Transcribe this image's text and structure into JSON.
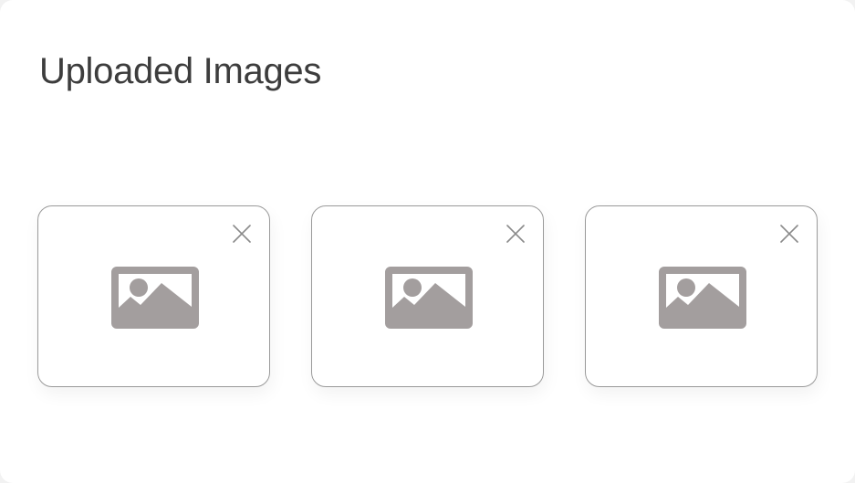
{
  "page": {
    "title": "Uploaded Images"
  },
  "uploads": [
    {
      "icon": "image-placeholder-icon",
      "remove_icon": "close-icon"
    },
    {
      "icon": "image-placeholder-icon",
      "remove_icon": "close-icon"
    },
    {
      "icon": "image-placeholder-icon",
      "remove_icon": "close-icon"
    }
  ],
  "colors": {
    "title": "#3d3d3d",
    "card_border": "#9a9a9a",
    "placeholder_icon": "#a39e9e",
    "close_icon": "#8a8a8a",
    "background": "#ffffff"
  }
}
